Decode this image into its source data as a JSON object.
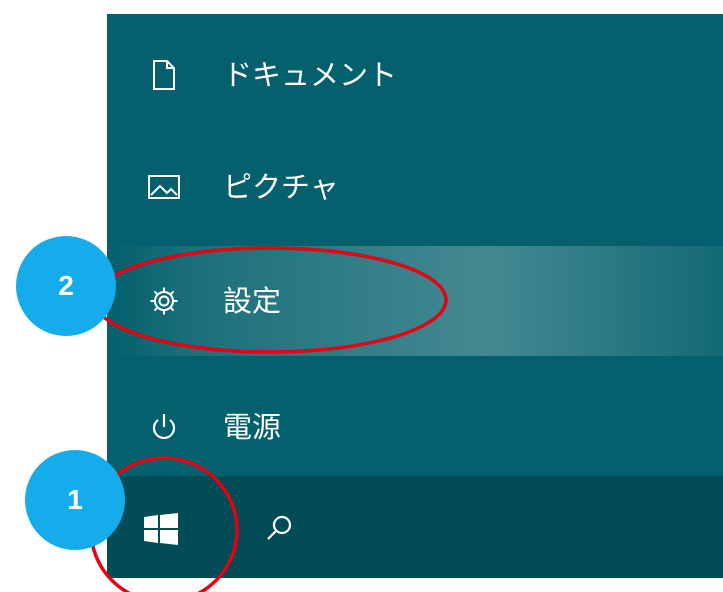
{
  "start_menu": {
    "items": [
      {
        "label": "ドキュメント",
        "icon": "document-icon"
      },
      {
        "label": "ピクチャ",
        "icon": "pictures-icon"
      },
      {
        "label": "設定",
        "icon": "gear-icon"
      },
      {
        "label": "電源",
        "icon": "power-icon"
      }
    ]
  },
  "taskbar": {
    "start_icon": "windows-logo-icon",
    "search_icon": "search-icon"
  },
  "annotations": {
    "step_badges": [
      "1",
      "2"
    ],
    "badge_color": "#16acec",
    "highlight_color": "#e60012"
  },
  "colors": {
    "menu_background": "#03606c",
    "taskbar_background": "#024c55",
    "text": "#ffffff"
  }
}
